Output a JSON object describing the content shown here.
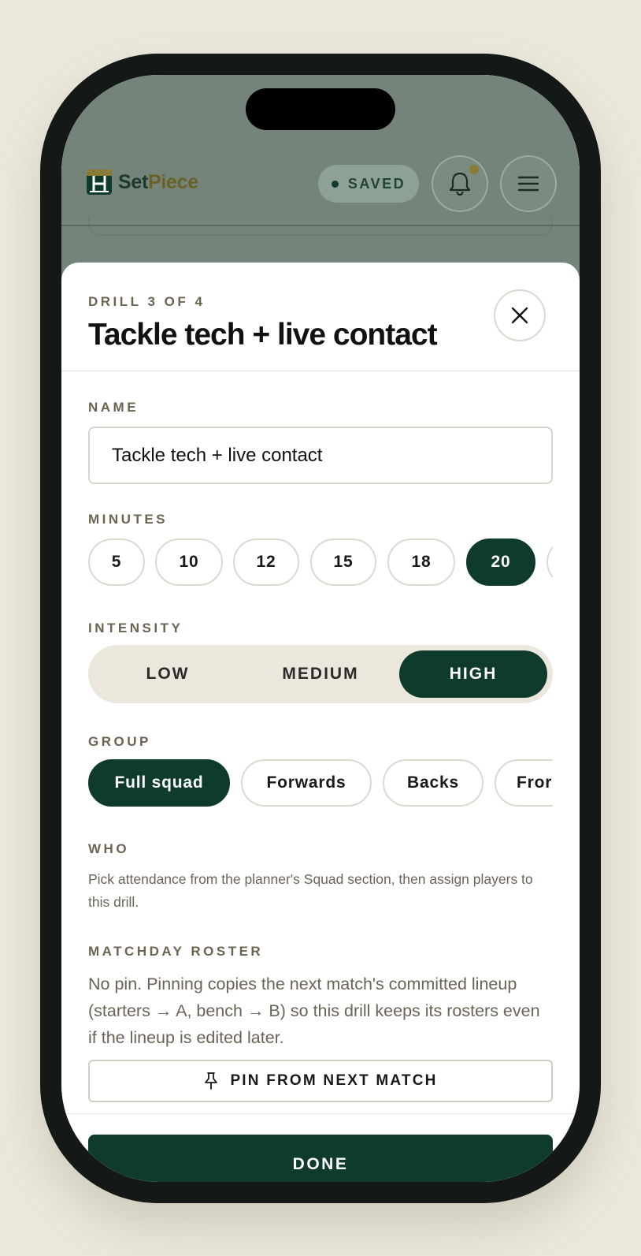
{
  "app": {
    "brand_part1": "Set",
    "brand_part2": "Piece",
    "saved_label": "SAVED"
  },
  "colors": {
    "brand_dark": "#0f3b2d",
    "accent_olive": "#6b6126",
    "muted_label": "#6b6451",
    "page_bg": "#ece8dc"
  },
  "icons": {
    "logo": "goalpost-logo-icon",
    "notifications": "bell-icon",
    "menu": "hamburger-menu-icon",
    "close": "close-icon",
    "pin": "pin-icon"
  },
  "sheet": {
    "eyebrow": "DRILL 3 OF 4",
    "title": "Tackle tech + live contact"
  },
  "name": {
    "label": "NAME",
    "value": "Tackle tech + live contact"
  },
  "minutes": {
    "label": "MINUTES",
    "options": [
      "5",
      "10",
      "12",
      "15",
      "18",
      "20"
    ],
    "selected": "20"
  },
  "intensity": {
    "label": "INTENSITY",
    "options": [
      "LOW",
      "MEDIUM",
      "HIGH"
    ],
    "selected": "HIGH"
  },
  "group": {
    "label": "GROUP",
    "options": [
      "Full squad",
      "Forwards",
      "Backs",
      "Fror"
    ],
    "selected": "Full squad"
  },
  "who": {
    "label": "WHO",
    "help": "Pick attendance from the planner's Squad section, then assign players to this drill."
  },
  "roster": {
    "label": "MATCHDAY ROSTER",
    "text": "No pin. Pinning copies the next match's committed lineup (starters → A, bench → B) so this drill keeps its rosters even if the lineup is edited later.",
    "pin_label": "PIN FROM NEXT MATCH"
  },
  "footer": {
    "done_label": "DONE"
  }
}
